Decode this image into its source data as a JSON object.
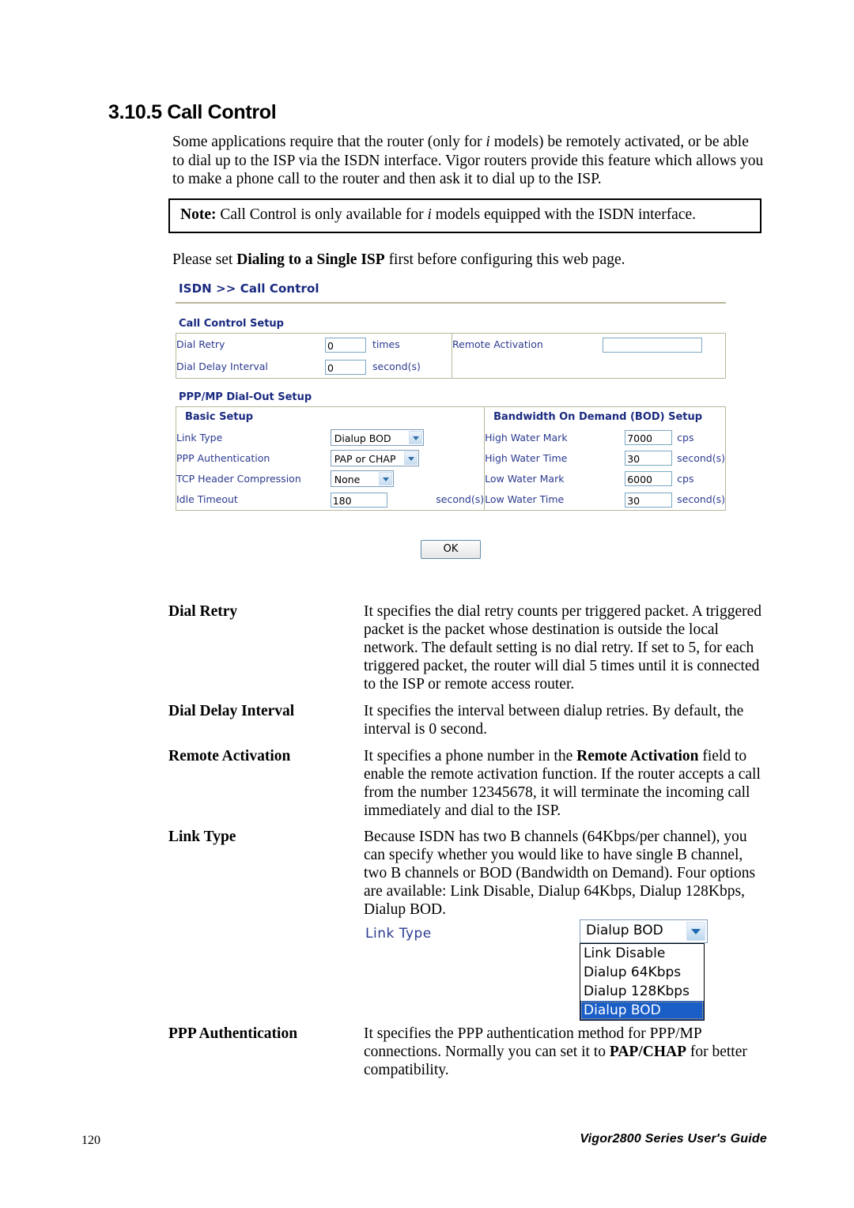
{
  "page": {
    "section_number": "3.10.5",
    "section_title": "Call Control",
    "heading": "3.10.5 Call Control",
    "footer_page_number": "120",
    "footer_title": "Vigor2800 Series User's Guide"
  },
  "intro": {
    "part1": "Some applications require that the router (only for ",
    "italic1": "i",
    "part2": " models) be remotely activated, or be able to dial up to the ISP via the ISDN interface. Vigor routers provide this feature which allows you to make a phone call to the router and then ask it to dial up to the ISP."
  },
  "note": {
    "label": "Note:",
    "part1": " Call Control is only available for ",
    "italic1": "i",
    "part2": " models equipped with the ISDN interface."
  },
  "please_set": {
    "part1": "Please set ",
    "bold1": "Dialing to a Single ISP",
    "part2": " first before configuring this web page."
  },
  "router_ui": {
    "breadcrumb": "ISDN >> Call Control",
    "call_control_setup": {
      "title": "Call Control Setup",
      "dial_retry": {
        "label": "Dial Retry",
        "value": "0",
        "unit": "times"
      },
      "dial_delay_interval": {
        "label": "Dial Delay Interval",
        "value": "0",
        "unit": "second(s)"
      },
      "remote_activation": {
        "label": "Remote Activation",
        "value": ""
      }
    },
    "ppp_mp_setup": {
      "title": "PPP/MP Dial-Out Setup",
      "basic_setup": {
        "title": "Basic Setup",
        "link_type": {
          "label": "Link Type",
          "value": "Dialup BOD"
        },
        "ppp_authentication": {
          "label": "PPP Authentication",
          "value": "PAP or CHAP"
        },
        "tcp_header_compression": {
          "label": "TCP Header Compression",
          "value": "None"
        },
        "idle_timeout": {
          "label": "Idle Timeout",
          "value": "180",
          "unit": "second(s)"
        }
      },
      "bod_setup": {
        "title": "Bandwidth On Demand (BOD) Setup",
        "high_water_mark": {
          "label": "High Water Mark",
          "value": "7000",
          "unit": "cps"
        },
        "high_water_time": {
          "label": "High Water Time",
          "value": "30",
          "unit": "second(s)"
        },
        "low_water_mark": {
          "label": "Low Water Mark",
          "value": "6000",
          "unit": "cps"
        },
        "low_water_time": {
          "label": "Low Water Time",
          "value": "30",
          "unit": "second(s)"
        }
      }
    },
    "ok_button": "OK"
  },
  "definitions": {
    "dial_retry": {
      "term": "Dial Retry",
      "desc": "It specifies the dial retry counts per triggered packet. A triggered packet is the packet whose destination is outside the local network. The default setting is no dial retry. If set to 5, for each triggered packet, the router will dial 5 times until it is connected to the ISP or remote access router."
    },
    "dial_delay_interval": {
      "term": "Dial Delay Interval",
      "desc": "It specifies the interval between dialup retries. By default, the interval is 0 second."
    },
    "remote_activation": {
      "term": "Remote Activation",
      "desc_part1": "It specifies a phone number in the ",
      "desc_bold1": "Remote Activation",
      "desc_part2": " field to enable the remote activation function. If the router accepts a call from the number 12345678, it will terminate the incoming call immediately and dial to the ISP."
    },
    "link_type": {
      "term": "Link Type",
      "desc": "Because ISDN has two B channels (64Kbps/per channel), you can specify whether you would like to have single B channel, two B channels or BOD (Bandwidth on Demand). Four options are available: Link Disable, Dialup 64Kbps, Dialup 128Kbps, Dialup BOD."
    },
    "ppp_authentication": {
      "term": "PPP Authentication",
      "desc_part1": "It specifies the PPP authentication method for PPP/MP connections. Normally you can set it to ",
      "desc_bold1": "PAP/CHAP",
      "desc_part2": " for better compatibility."
    }
  },
  "dropdown_illustration": {
    "label": "Link Type",
    "selected_value": "Dialup BOD",
    "options": [
      "Link Disable",
      "Dialup 64Kbps",
      "Dialup 128Kbps",
      "Dialup BOD"
    ],
    "selected_index": 3
  },
  "colors": {
    "ui_text_blue": "#2b3a8f",
    "ui_heading_blue": "#1a2a80",
    "table_border": "#b9b79a",
    "input_border": "#7ba7c4",
    "select_highlight": "#1a5ec8"
  }
}
